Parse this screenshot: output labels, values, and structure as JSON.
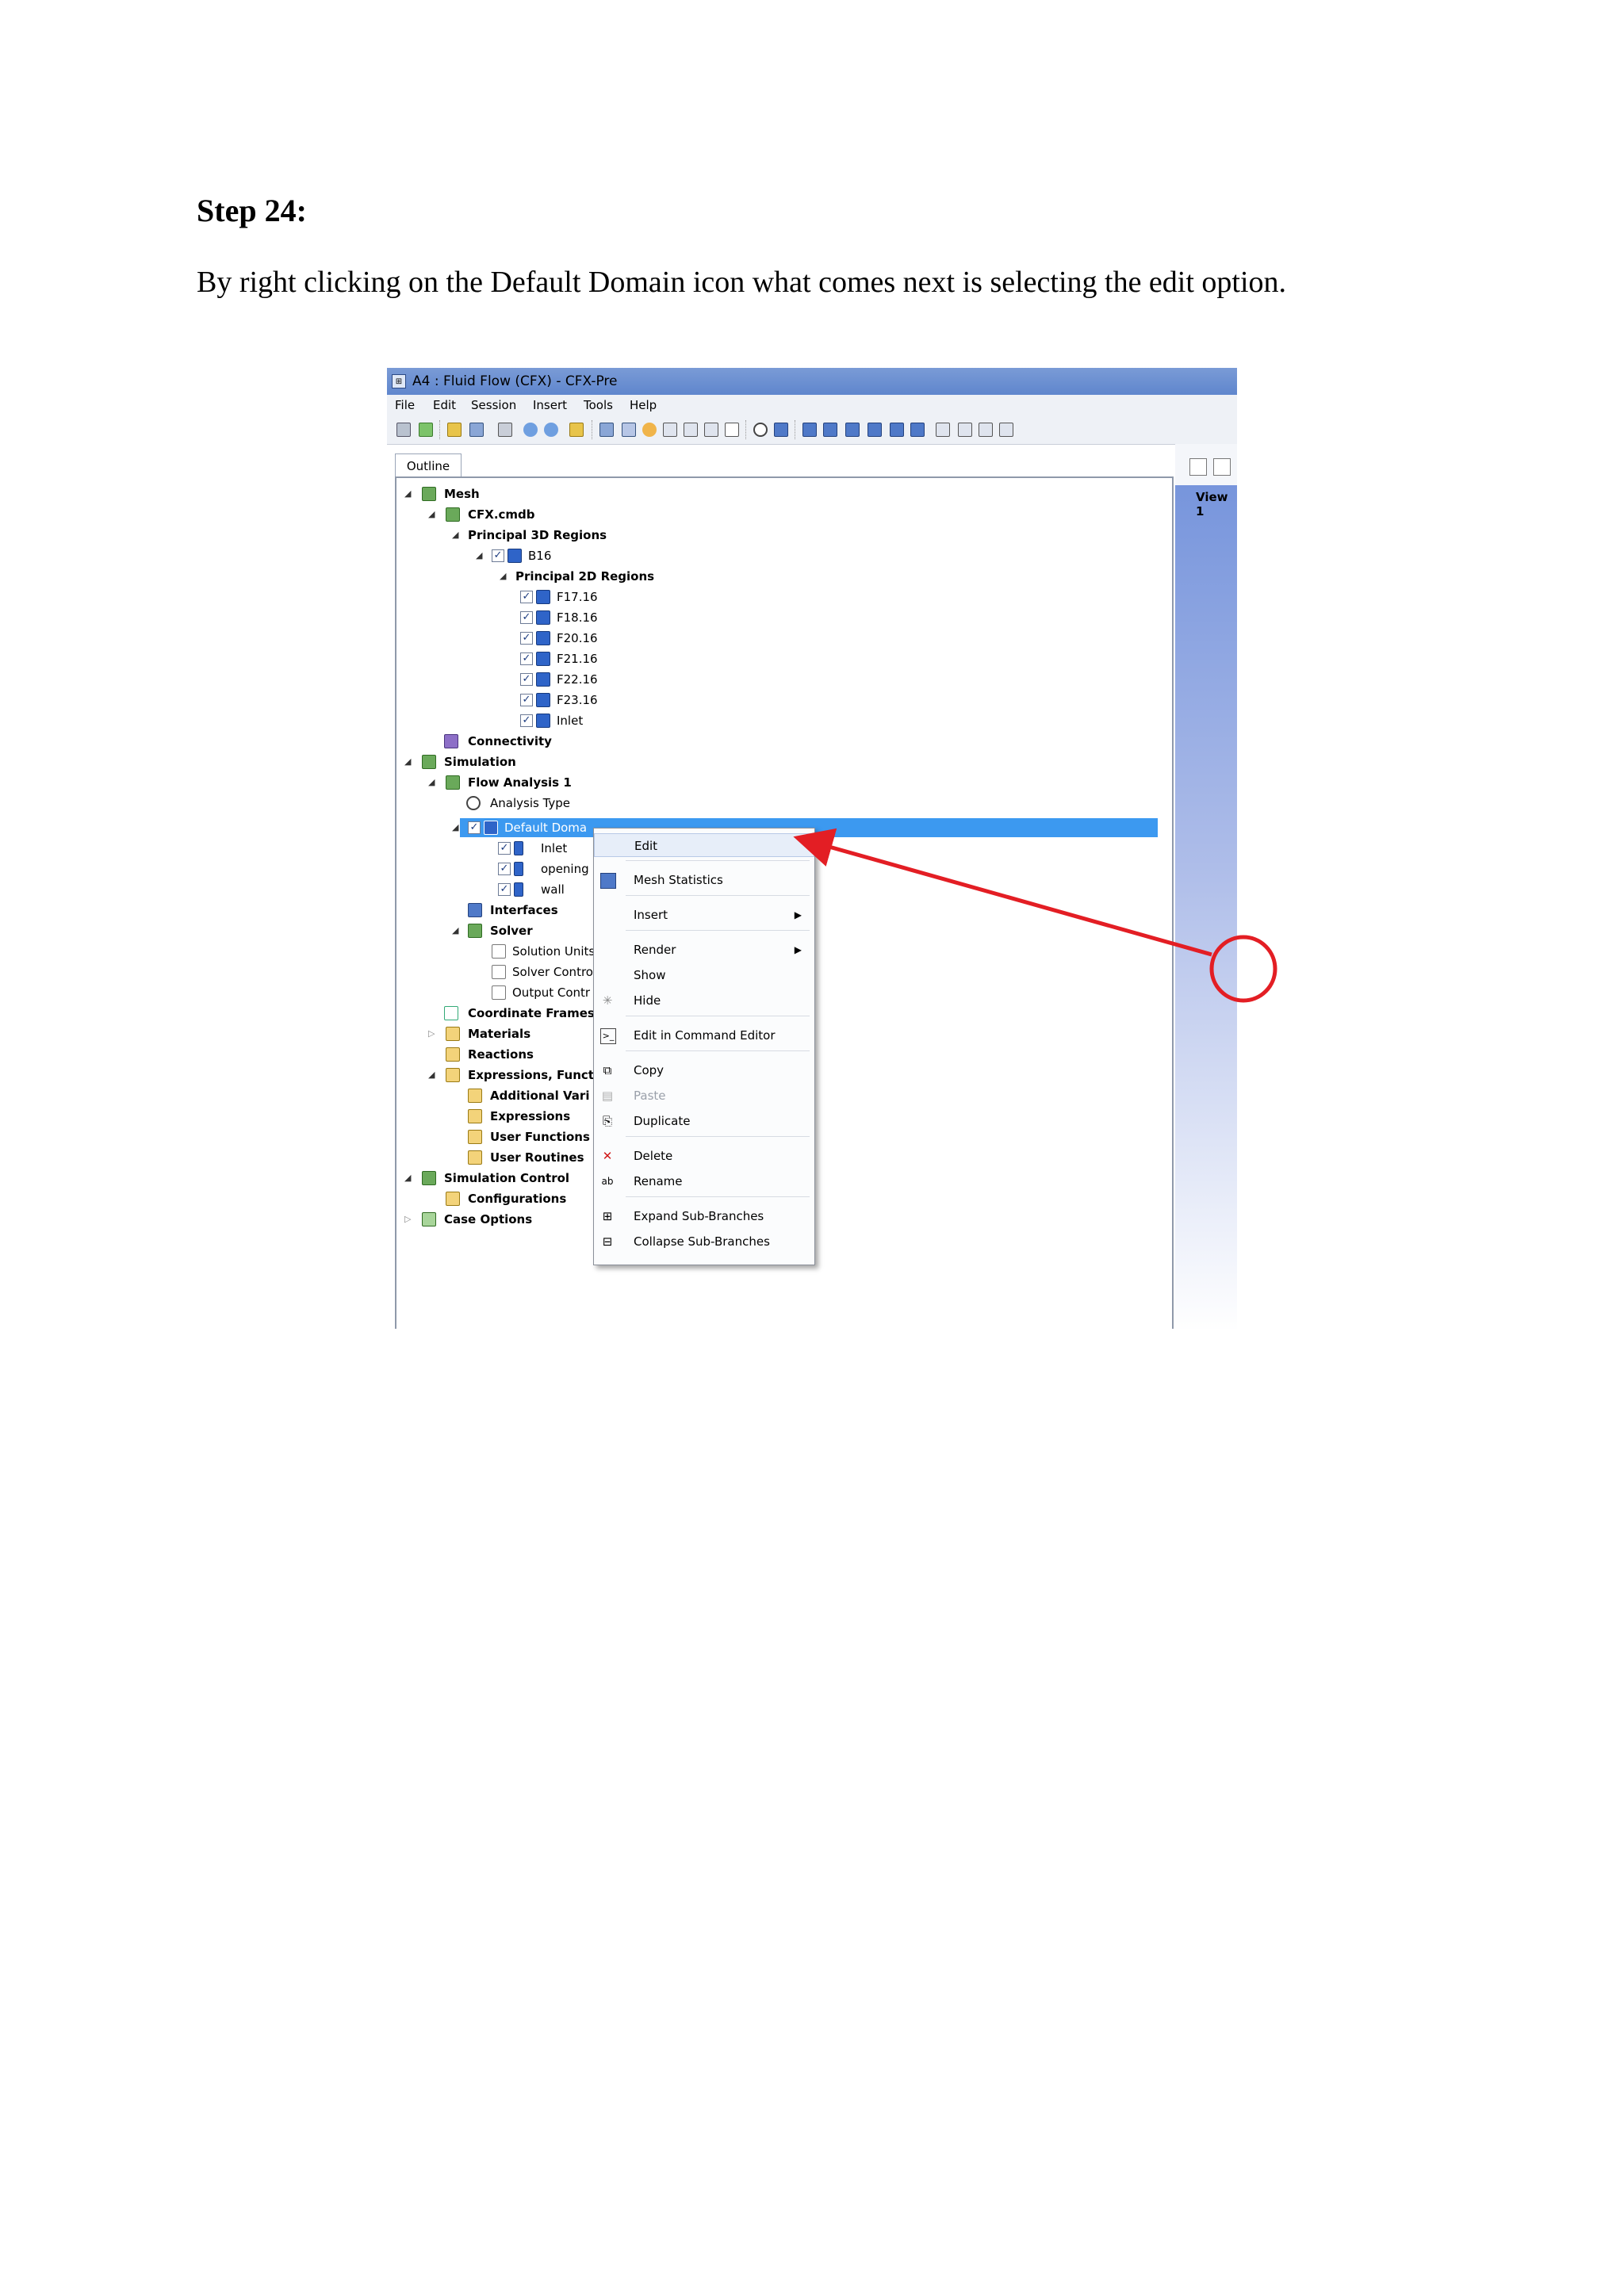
{
  "document": {
    "heading": "Step 24:",
    "body": "By right clicking on the Default Domain icon what comes next is selecting the edit option."
  },
  "window": {
    "title": "A4 : Fluid Flow (CFX) - CFX-Pre",
    "menus": [
      "File",
      "Edit",
      "Session",
      "Insert",
      "Tools",
      "Help"
    ],
    "outline_tab": "Outline",
    "view_label": "View 1"
  },
  "tree": [
    {
      "label": "Mesh",
      "bold": true
    },
    {
      "label": "CFX.cmdb",
      "bold": true
    },
    {
      "label": "Principal 3D Regions",
      "bold": true
    },
    {
      "label": "B16",
      "bold": false
    },
    {
      "label": "Principal 2D Regions",
      "bold": true
    },
    {
      "label": "F17.16",
      "bold": false
    },
    {
      "label": "F18.16",
      "bold": false
    },
    {
      "label": "F20.16",
      "bold": false
    },
    {
      "label": "F21.16",
      "bold": false
    },
    {
      "label": "F22.16",
      "bold": false
    },
    {
      "label": "F23.16",
      "bold": false
    },
    {
      "label": "Inlet",
      "bold": false
    },
    {
      "label": "Connectivity",
      "bold": true
    },
    {
      "label": "Simulation",
      "bold": true
    },
    {
      "label": "Flow Analysis 1",
      "bold": true
    },
    {
      "label": "Analysis Type",
      "bold": false
    },
    {
      "label": "Default Doma",
      "bold": false,
      "selected": true
    },
    {
      "label": "Inlet",
      "bold": false
    },
    {
      "label": "opening",
      "bold": false
    },
    {
      "label": "wall",
      "bold": false
    },
    {
      "label": "Interfaces",
      "bold": true
    },
    {
      "label": "Solver",
      "bold": true
    },
    {
      "label": "Solution Units",
      "bold": false
    },
    {
      "label": "Solver Contro",
      "bold": false
    },
    {
      "label": "Output Contr",
      "bold": false
    },
    {
      "label": "Coordinate Frames",
      "bold": true
    },
    {
      "label": "Materials",
      "bold": true
    },
    {
      "label": "Reactions",
      "bold": true
    },
    {
      "label": "Expressions, Funct",
      "bold": true
    },
    {
      "label": "Additional Vari",
      "bold": true
    },
    {
      "label": "Expressions",
      "bold": true
    },
    {
      "label": "User Functions",
      "bold": true
    },
    {
      "label": "User Routines",
      "bold": true
    },
    {
      "label": "Simulation Control",
      "bold": true
    },
    {
      "label": "Configurations",
      "bold": true
    },
    {
      "label": "Case Options",
      "bold": true
    }
  ],
  "context_menu": [
    {
      "label": "Edit",
      "icon": "none",
      "highlighted": true
    },
    {
      "label": "Mesh Statistics",
      "icon": "mesh-statistics-icon"
    },
    {
      "label": "Insert",
      "icon": "none",
      "submenu": true
    },
    {
      "label": "Render",
      "icon": "none",
      "submenu": true
    },
    {
      "label": "Show",
      "icon": "none"
    },
    {
      "label": "Hide",
      "icon": "hide-icon"
    },
    {
      "label": "Edit in Command Editor",
      "icon": "command-editor-icon"
    },
    {
      "label": "Copy",
      "icon": "copy-icon"
    },
    {
      "label": "Paste",
      "icon": "paste-icon",
      "disabled": true
    },
    {
      "label": "Duplicate",
      "icon": "duplicate-icon"
    },
    {
      "label": "Delete",
      "icon": "delete-icon"
    },
    {
      "label": "Rename",
      "icon": "rename-icon"
    },
    {
      "label": "Expand Sub-Branches",
      "icon": "expand-icon"
    },
    {
      "label": "Collapse Sub-Branches",
      "icon": "collapse-icon"
    }
  ],
  "colors": {
    "selection": "#3c99f0",
    "annotation": "#e31e24",
    "titlebar": "#6a8fd1"
  }
}
